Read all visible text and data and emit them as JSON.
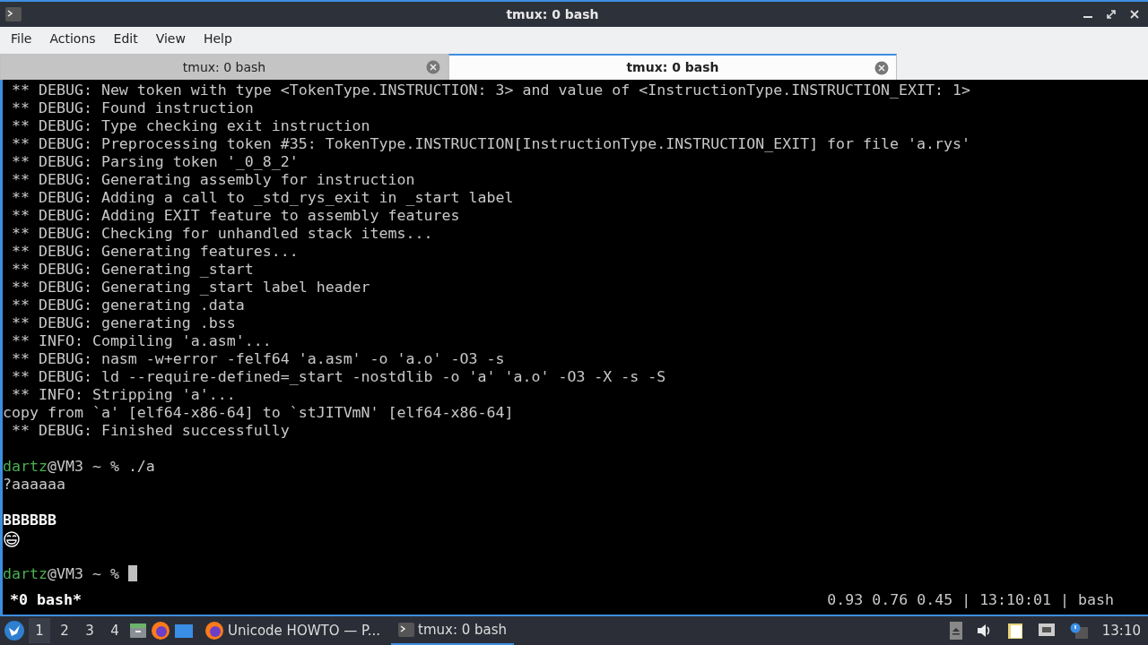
{
  "window": {
    "title": "tmux: 0 bash"
  },
  "menu": [
    "File",
    "Actions",
    "Edit",
    "View",
    "Help"
  ],
  "tabs": [
    {
      "label": "tmux: 0 bash",
      "selected": false
    },
    {
      "label": "tmux: 0 bash",
      "selected": true
    }
  ],
  "terminal": {
    "lines": [
      {
        "kind": "text",
        "text": " ** DEBUG: New token with type <TokenType.INSTRUCTION: 3> and value of <InstructionType.INSTRUCTION_EXIT: 1>"
      },
      {
        "kind": "text",
        "text": " ** DEBUG: Found instruction"
      },
      {
        "kind": "text",
        "text": " ** DEBUG: Type checking exit instruction"
      },
      {
        "kind": "text",
        "text": " ** DEBUG: Preprocessing token #35: TokenType.INSTRUCTION[InstructionType.INSTRUCTION_EXIT] for file 'a.rys'"
      },
      {
        "kind": "text",
        "text": " ** DEBUG: Parsing token '_0_8_2'"
      },
      {
        "kind": "text",
        "text": " ** DEBUG: Generating assembly for instruction"
      },
      {
        "kind": "text",
        "text": " ** DEBUG: Adding a call to _std_rys_exit in _start label"
      },
      {
        "kind": "text",
        "text": " ** DEBUG: Adding EXIT feature to assembly features"
      },
      {
        "kind": "text",
        "text": " ** DEBUG: Checking for unhandled stack items..."
      },
      {
        "kind": "text",
        "text": " ** DEBUG: Generating features..."
      },
      {
        "kind": "text",
        "text": " ** DEBUG: Generating _start"
      },
      {
        "kind": "text",
        "text": " ** DEBUG: Generating _start label header"
      },
      {
        "kind": "text",
        "text": " ** DEBUG: generating .data"
      },
      {
        "kind": "text",
        "text": " ** DEBUG: generating .bss"
      },
      {
        "kind": "text",
        "text": " ** INFO: Compiling 'a.asm'..."
      },
      {
        "kind": "text",
        "text": " ** DEBUG: nasm -w+error -felf64 'a.asm' -o 'a.o' -O3 -s"
      },
      {
        "kind": "text",
        "text": " ** DEBUG: ld --require-defined=_start -nostdlib -o 'a' 'a.o' -O3 -X -s -S"
      },
      {
        "kind": "text",
        "text": " ** INFO: Stripping 'a'..."
      },
      {
        "kind": "text",
        "text": "copy from `a' [elf64-x86-64] to `stJITVmN' [elf64-x86-64]"
      },
      {
        "kind": "text",
        "text": " ** DEBUG: Finished successfully"
      },
      {
        "kind": "blank"
      },
      {
        "kind": "prompt",
        "user": "dartz",
        "host": "@VM3 ~ % ",
        "command": "./a"
      },
      {
        "kind": "text",
        "text": "?aaaaaa"
      },
      {
        "kind": "blank"
      },
      {
        "kind": "bold",
        "text": "BBBBBB"
      },
      {
        "kind": "emoji"
      },
      {
        "kind": "blank"
      },
      {
        "kind": "prompt",
        "user": "dartz",
        "host": "@VM3 ~ % ",
        "cursor": true
      }
    ]
  },
  "status_line": {
    "window": "*0 bash*",
    "right": "0.93 0.76 0.45 | 13:10:01 | bash"
  },
  "taskbar": {
    "desktops": [
      {
        "label": "1",
        "selected": true
      },
      {
        "label": "2",
        "selected": false
      },
      {
        "label": "3",
        "selected": false
      },
      {
        "label": "4",
        "selected": false
      }
    ],
    "tasks": [
      {
        "label": "Unicode HOWTO — P...",
        "kind": "browser",
        "selected": false
      },
      {
        "label": "tmux: 0 bash",
        "kind": "terminal",
        "selected": true
      }
    ],
    "clock": "13:10"
  }
}
